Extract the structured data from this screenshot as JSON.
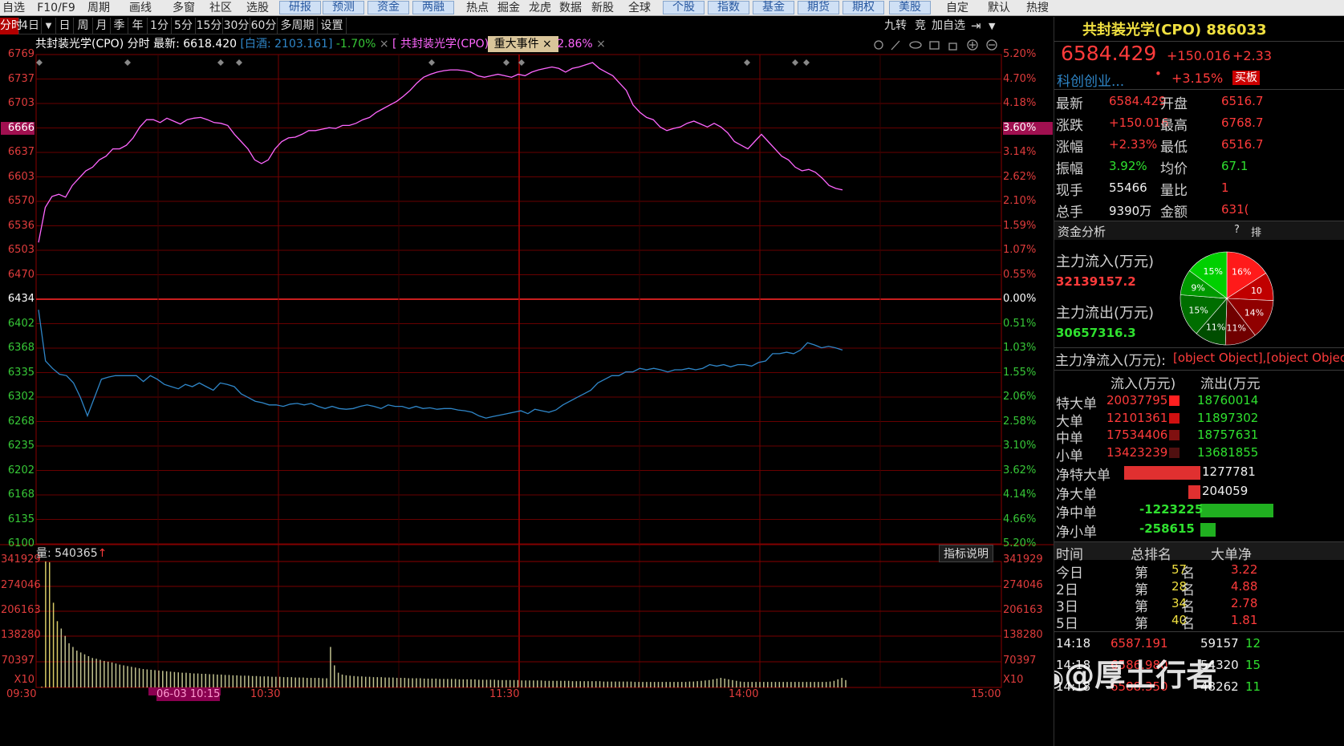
{
  "menu": {
    "plain": [
      "自选",
      "F10/F9",
      "周期",
      "画线",
      "多窗",
      "社区",
      "选股"
    ],
    "buttons": [
      "研报",
      "预测",
      "资金",
      "两融"
    ],
    "plain2": [
      "热点",
      "掘金",
      "龙虎",
      "数据",
      "新股",
      "全球"
    ],
    "buttons2": [
      "个股",
      "指数",
      "基金",
      "期货",
      "期权",
      "美股"
    ],
    "plain3": [
      "自定",
      "默认",
      "热搜"
    ]
  },
  "periods": [
    "分时",
    "4日",
    "▼",
    "日",
    "周",
    "月",
    "季",
    "年",
    "1分",
    "5分",
    "15分",
    "30分",
    "60分",
    "多周期",
    "设置"
  ],
  "right_tools": {
    "jiuzhuan": "九转",
    "jing": "竞",
    "add_watch": "加自选",
    "arrow_icon": "⇥",
    "dropdown": "▼"
  },
  "info": {
    "name": "共封装光学(CPO)",
    "mode": "分时",
    "latest_label": "最新:",
    "latest": "6618.420",
    "compare": "[白酒: 2103.161]",
    "compare_pct": "-1.70%",
    "close1": "×",
    "tab2": "[ 共封装光学(CPO)",
    "event": "重大事件",
    "close2": "×",
    "pct2": "2.86%",
    "close3": "×"
  },
  "chart_data": {
    "type": "line",
    "y_left": [
      "6769",
      "6737",
      "6703",
      "6666",
      "6637",
      "6603",
      "6570",
      "6536",
      "6503",
      "6470",
      "6434",
      "6402",
      "6368",
      "6335",
      "6302",
      "6268",
      "6235",
      "6202",
      "6168",
      "6135",
      "6100"
    ],
    "y_right": [
      "5.20%",
      "4.70%",
      "4.18%",
      "3.60%",
      "3.14%",
      "2.62%",
      "2.10%",
      "1.59%",
      "1.07%",
      "0.55%",
      "0.00%",
      "0.51%",
      "1.03%",
      "1.55%",
      "2.06%",
      "2.58%",
      "3.10%",
      "3.62%",
      "4.14%",
      "4.66%",
      "5.20%"
    ],
    "y_highlight": "6666",
    "y_highlight_right": "3.60%",
    "base": "6434",
    "base_right": "0.00%",
    "ylim": [
      6100,
      6769
    ],
    "x_labels": [
      "09:30",
      "06-03 10:15",
      "10:30",
      "11:30",
      "14:00",
      "15:00"
    ],
    "volume_label": "量: 540365",
    "volume_arrow": "↑",
    "indicator_btn": "指标说明",
    "vol_axis": [
      "341929",
      "274046",
      "206163",
      "138280",
      "70397",
      "X10"
    ],
    "series": [
      {
        "name": "共封装光学(CPO)",
        "color": "#ff66ff",
        "values": [
          6512,
          6560,
          6575,
          6578,
          6574,
          6590,
          6600,
          6610,
          6615,
          6625,
          6630,
          6640,
          6640,
          6645,
          6655,
          6670,
          6680,
          6680,
          6676,
          6682,
          6678,
          6674,
          6680,
          6682,
          6683,
          6680,
          6676,
          6675,
          6672,
          6660,
          6650,
          6640,
          6625,
          6620,
          6625,
          6640,
          6650,
          6655,
          6656,
          6660,
          6665,
          6665,
          6667,
          6669,
          6668,
          6672,
          6672,
          6675,
          6680,
          6683,
          6690,
          6695,
          6700,
          6705,
          6712,
          6720,
          6730,
          6738,
          6742,
          6745,
          6747,
          6748,
          6748,
          6747,
          6745,
          6740,
          6738,
          6740,
          6742,
          6740,
          6738,
          6742,
          6740,
          6745,
          6748,
          6750,
          6752,
          6750,
          6745,
          6750,
          6752,
          6755,
          6758,
          6750,
          6745,
          6740,
          6730,
          6720,
          6700,
          6690,
          6683,
          6680,
          6670,
          6665,
          6668,
          6670,
          6675,
          6678,
          6674,
          6670,
          6675,
          6670,
          6662,
          6650,
          6645,
          6640,
          6650,
          6660,
          6650,
          6640,
          6630,
          6625,
          6615,
          6610,
          6612,
          6608,
          6600,
          6590,
          6586,
          6584
        ]
      },
      {
        "name": "白酒",
        "color": "#2f86c8",
        "values": [
          6420,
          6350,
          6340,
          6332,
          6330,
          6320,
          6300,
          6275,
          6300,
          6325,
          6328,
          6330,
          6330,
          6330,
          6330,
          6322,
          6330,
          6325,
          6318,
          6315,
          6312,
          6318,
          6315,
          6320,
          6315,
          6310,
          6320,
          6318,
          6315,
          6305,
          6300,
          6295,
          6293,
          6290,
          6290,
          6288,
          6291,
          6292,
          6290,
          6292,
          6288,
          6285,
          6288,
          6285,
          6284,
          6285,
          6288,
          6290,
          6288,
          6285,
          6290,
          6288,
          6288,
          6285,
          6288,
          6285,
          6286,
          6284,
          6285,
          6285,
          6283,
          6282,
          6280,
          6275,
          6272,
          6274,
          6276,
          6278,
          6280,
          6282,
          6278,
          6284,
          6282,
          6280,
          6283,
          6290,
          6295,
          6300,
          6305,
          6310,
          6320,
          6325,
          6330,
          6330,
          6335,
          6335,
          6340,
          6338,
          6340,
          6338,
          6335,
          6338,
          6338,
          6340,
          6338,
          6340,
          6345,
          6343,
          6345,
          6342,
          6345,
          6345,
          6343,
          6348,
          6350,
          6360,
          6360,
          6362,
          6360,
          6365,
          6375,
          6372,
          6368,
          6370,
          6368,
          6365
        ]
      }
    ],
    "volume": [
      300,
      341929,
      340000,
      230000,
      180000,
      160000,
      140000,
      120000,
      110000,
      100000,
      95000,
      90000,
      85000,
      80000,
      78000,
      75000,
      72000,
      70000,
      68000,
      65000,
      62000,
      60000,
      58000,
      56000,
      54000,
      52000,
      50000,
      49000,
      48000,
      47000,
      46000,
      45000,
      44000,
      43000,
      42000,
      41000,
      40000,
      40000,
      39000,
      38000,
      38000,
      37000,
      37000,
      36000,
      36000,
      35000,
      35000,
      34000,
      34000,
      33000,
      33000,
      32000,
      32000,
      32000,
      31000,
      31000,
      30000,
      30000,
      30000,
      29000,
      29000,
      29000,
      28000,
      28000,
      28000,
      27000,
      27000,
      27000,
      26000,
      26000,
      26000,
      26000,
      25000,
      25000,
      110000,
      60000,
      40000,
      35000,
      33000,
      32000,
      31000,
      30000,
      30000,
      29000,
      29000,
      28000,
      28000,
      28000,
      27000,
      27000,
      27000,
      26000,
      26000,
      26000,
      25000,
      25000,
      25000,
      25000,
      24000,
      24000,
      24000,
      24000,
      23000,
      23000,
      23000,
      23000,
      23000,
      22000,
      22000,
      22000,
      22000,
      22000,
      21000,
      21000,
      21000,
      21000,
      21000,
      20000,
      20000,
      20000,
      20000,
      20000,
      20000,
      19000,
      19000,
      19000,
      19000,
      19000,
      19000,
      18000,
      18000,
      18000,
      18000,
      18000,
      18000,
      18000,
      17000,
      17000,
      17000,
      17000,
      17000,
      17000,
      17000,
      17000,
      16000,
      16000,
      16000,
      16000,
      16000,
      16000,
      16000,
      16000,
      15000,
      15000,
      15000,
      15000,
      15000,
      15000,
      15000,
      15000,
      15000,
      15000,
      15000,
      15000,
      15000,
      15000,
      16000,
      16000,
      17000,
      18000,
      19000,
      20000,
      22000,
      24000,
      26000,
      24000,
      22000,
      20000,
      18000,
      16000,
      15000,
      15000,
      15000,
      15000,
      15000,
      15000,
      15000,
      15000,
      15000,
      15000,
      15000,
      15000,
      15000,
      15000,
      15000,
      15000,
      15000,
      15000,
      15000,
      15000,
      15000,
      15000,
      16000,
      18000,
      22000,
      26000,
      20000
    ]
  },
  "right": {
    "title": "共封装光学(CPO) 886033",
    "price": "6584.429",
    "change": "+150.016",
    "change_pct": "+2.33",
    "sector": "科创创业...",
    "dot": "•",
    "sector_pct": "+3.15%",
    "btn": "买板",
    "stats": [
      {
        "l": "最新",
        "v": "6584.429",
        "l2": "开盘",
        "v2": "6516.7"
      },
      {
        "l": "涨跌",
        "v": "+150.016",
        "l2": "最高",
        "v2": "6768.7"
      },
      {
        "l": "涨幅",
        "v": "+2.33%",
        "l2": "最低",
        "v2": "6516.7"
      },
      {
        "l": "振幅",
        "v": "3.92%",
        "l2": "均价",
        "v2": "67.1"
      },
      {
        "l": "现手",
        "v": "55466",
        "l2": "量比",
        "v2": "1"
      },
      {
        "l": "总手",
        "v": "9390万",
        "l2": "金额",
        "v2": "631("
      }
    ],
    "fund_title": "资金分析",
    "fund_q": "?",
    "fund_more": "排",
    "inflow_label": "主力流入(万元)",
    "inflow": "32139157.2",
    "outflow_label": "主力流出(万元)",
    "outflow": "30657316.3",
    "net_label": "主力净流入(万元):",
    "net": [
      {
        "l": "净特大单",
        "v": "1277781",
        "n": 1277781
      },
      {
        "l": "净大单",
        "v": "204059",
        "n": 204059
      },
      {
        "l": "净中单",
        "v": "-1223225",
        "n": -1223225
      },
      {
        "l": "净小单",
        "v": "-258615",
        "n": -258615
      }
    ],
    "pie": [
      {
        "label": "16%",
        "color": "#ff1a1a",
        "value": 16
      },
      {
        "label": "10",
        "color": "#c00000",
        "value": 10
      },
      {
        "label": "14%",
        "color": "#900000",
        "value": 14
      },
      {
        "label": "11%",
        "color": "#700000",
        "value": 11
      },
      {
        "label": "11%",
        "color": "#004d00",
        "value": 11
      },
      {
        "label": "15%",
        "color": "#006e00",
        "value": 15
      },
      {
        "label": "9%",
        "color": "#009a00",
        "value": 9
      },
      {
        "label": "15%",
        "color": "#00d000",
        "value": 15
      }
    ],
    "flow_head": [
      "流入(万元)",
      "流出(万元"
    ],
    "flow": [
      {
        "l": "特大单",
        "in": "20037795",
        "out": "18760014"
      },
      {
        "l": "大单",
        "in": "12101361",
        "out": "11897302"
      },
      {
        "l": "中单",
        "in": "17534406",
        "out": "18757631"
      },
      {
        "l": "小单",
        "in": "13423239",
        "out": "13681855"
      }
    ],
    "rank_head": [
      "时间",
      "总排名",
      "大单净"
    ],
    "rank": [
      {
        "t": "今日",
        "d": "第",
        "r": "57",
        "m": "名",
        "p": "3.22"
      },
      {
        "t": "2日",
        "d": "第",
        "r": "28",
        "m": "名",
        "p": "4.88"
      },
      {
        "t": "3日",
        "d": "第",
        "r": "34",
        "m": "名",
        "p": "2.78"
      },
      {
        "t": "5日",
        "d": "第",
        "r": "40",
        "m": "名",
        "p": "1.81"
      }
    ],
    "ticks": [
      {
        "t": "14:18",
        "p": "6587.191",
        "v": "59157",
        "x": "12"
      },
      {
        "t": "14:18",
        "p": "6586.980",
        "v": "54320",
        "x": "15"
      },
      {
        "t": "14:18",
        "p": "6588.350",
        "v": "48262",
        "x": "11"
      }
    ]
  },
  "watermark": "@厚土行者"
}
